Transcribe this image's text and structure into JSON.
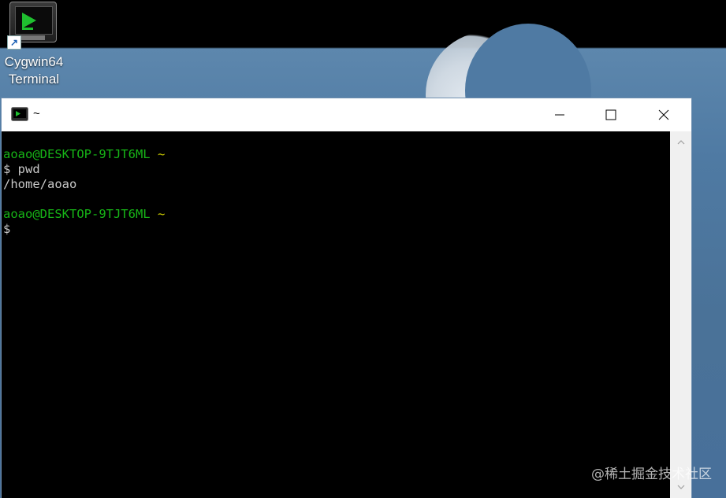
{
  "desktop": {
    "icon": {
      "name": "cygwin-terminal-icon",
      "label_line1": "Cygwin64",
      "label_line2": "Terminal"
    }
  },
  "window": {
    "title": "~",
    "buttons": {
      "minimize": "minimize-icon",
      "maximize": "maximize-icon",
      "close": "close-icon"
    }
  },
  "console": {
    "lines": [
      {
        "prompt_user": "aoao@DESKTOP-9TJT6ML",
        "prompt_dir": "~"
      },
      {
        "text": "$ pwd"
      },
      {
        "text": "/home/aoao"
      },
      {
        "text": ""
      },
      {
        "prompt_user": "aoao@DESKTOP-9TJT6ML",
        "prompt_dir": "~"
      },
      {
        "text": "$"
      }
    ]
  },
  "watermark": "@稀土掘金技术社区",
  "colors": {
    "prompt_user": "#17b417",
    "prompt_dir": "#c8c800",
    "console_text": "#c8c8c8",
    "console_bg": "#000000"
  }
}
